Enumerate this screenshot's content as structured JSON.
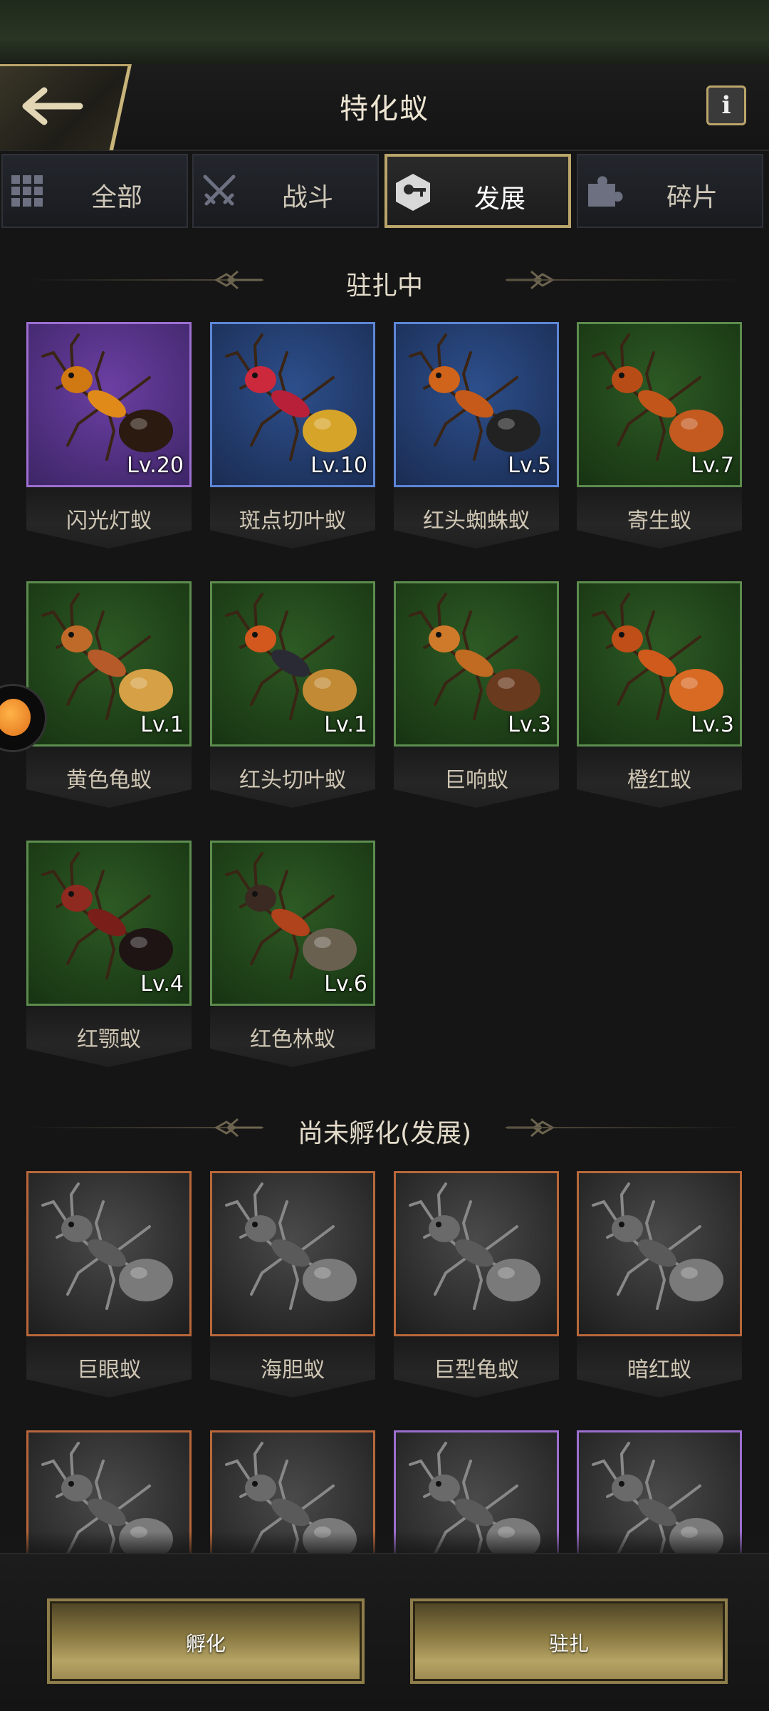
{
  "header": {
    "title": "特化蚁",
    "info_label": "i"
  },
  "tabs": [
    {
      "label": "全部",
      "icon": "grid-icon",
      "active": false
    },
    {
      "label": "战斗",
      "icon": "crossed-swords-icon",
      "active": false
    },
    {
      "label": "发展",
      "icon": "hexagon-key-icon",
      "active": true
    },
    {
      "label": "碎片",
      "icon": "puzzle-piece-icon",
      "active": false
    }
  ],
  "sections": {
    "stationed": {
      "title": "驻扎中",
      "ants": [
        {
          "name": "闪光灯蚁",
          "level": "Lv.20",
          "rarity": "purple",
          "body": "#e08a1a",
          "head": "#d07812",
          "abdomen": "#2a1a10"
        },
        {
          "name": "斑点切叶蚁",
          "level": "Lv.10",
          "rarity": "blue",
          "body": "#b8203a",
          "head": "#cc2a3c",
          "abdomen": "#d7a42a"
        },
        {
          "name": "红头蜘蛛蚁",
          "level": "Lv.5",
          "rarity": "blue",
          "body": "#c65a1a",
          "head": "#d0641a",
          "abdomen": "#222222"
        },
        {
          "name": "寄生蚁",
          "level": "Lv.7",
          "rarity": "green",
          "body": "#c2561a",
          "head": "#b84c16",
          "abdomen": "#c45a20"
        },
        {
          "name": "黄色龟蚁",
          "level": "Lv.1",
          "rarity": "green",
          "body": "#b55a28",
          "head": "#c06a2a",
          "abdomen": "#d6a046"
        },
        {
          "name": "红头切叶蚁",
          "level": "Lv.1",
          "rarity": "green",
          "body": "#2a2a35",
          "head": "#d2581e",
          "abdomen": "#c28a34"
        },
        {
          "name": "巨响蚁",
          "level": "Lv.3",
          "rarity": "green",
          "body": "#c06a22",
          "head": "#cf7a2a",
          "abdomen": "#6a3a1e"
        },
        {
          "name": "橙红蚁",
          "level": "Lv.3",
          "rarity": "green",
          "body": "#cf5a1c",
          "head": "#c04e18",
          "abdomen": "#d86a24"
        },
        {
          "name": "红颚蚁",
          "level": "Lv.4",
          "rarity": "green",
          "body": "#7a1e1a",
          "head": "#8e2a20",
          "abdomen": "#1e1414"
        },
        {
          "name": "红色林蚁",
          "level": "Lv.6",
          "rarity": "green",
          "body": "#b0421c",
          "head": "#3a2a22",
          "abdomen": "#6a6050"
        }
      ]
    },
    "unhatched": {
      "title": "尚未孵化(发展)",
      "ants": [
        {
          "name": "巨眼蚁",
          "rarity": "grey-orange"
        },
        {
          "name": "海胆蚁",
          "rarity": "grey-orange"
        },
        {
          "name": "巨型龟蚁",
          "rarity": "grey-orange"
        },
        {
          "name": "暗红蚁",
          "rarity": "grey-orange"
        },
        {
          "name": "",
          "rarity": "grey-orange"
        },
        {
          "name": "",
          "rarity": "grey-orange"
        },
        {
          "name": "",
          "rarity": "grey-purple"
        },
        {
          "name": "",
          "rarity": "grey-purple"
        }
      ]
    }
  },
  "buttons": {
    "hatch": "孵化",
    "station": "驻扎"
  },
  "colors": {
    "accent_gold": "#b9a46a",
    "background": "#151515"
  }
}
